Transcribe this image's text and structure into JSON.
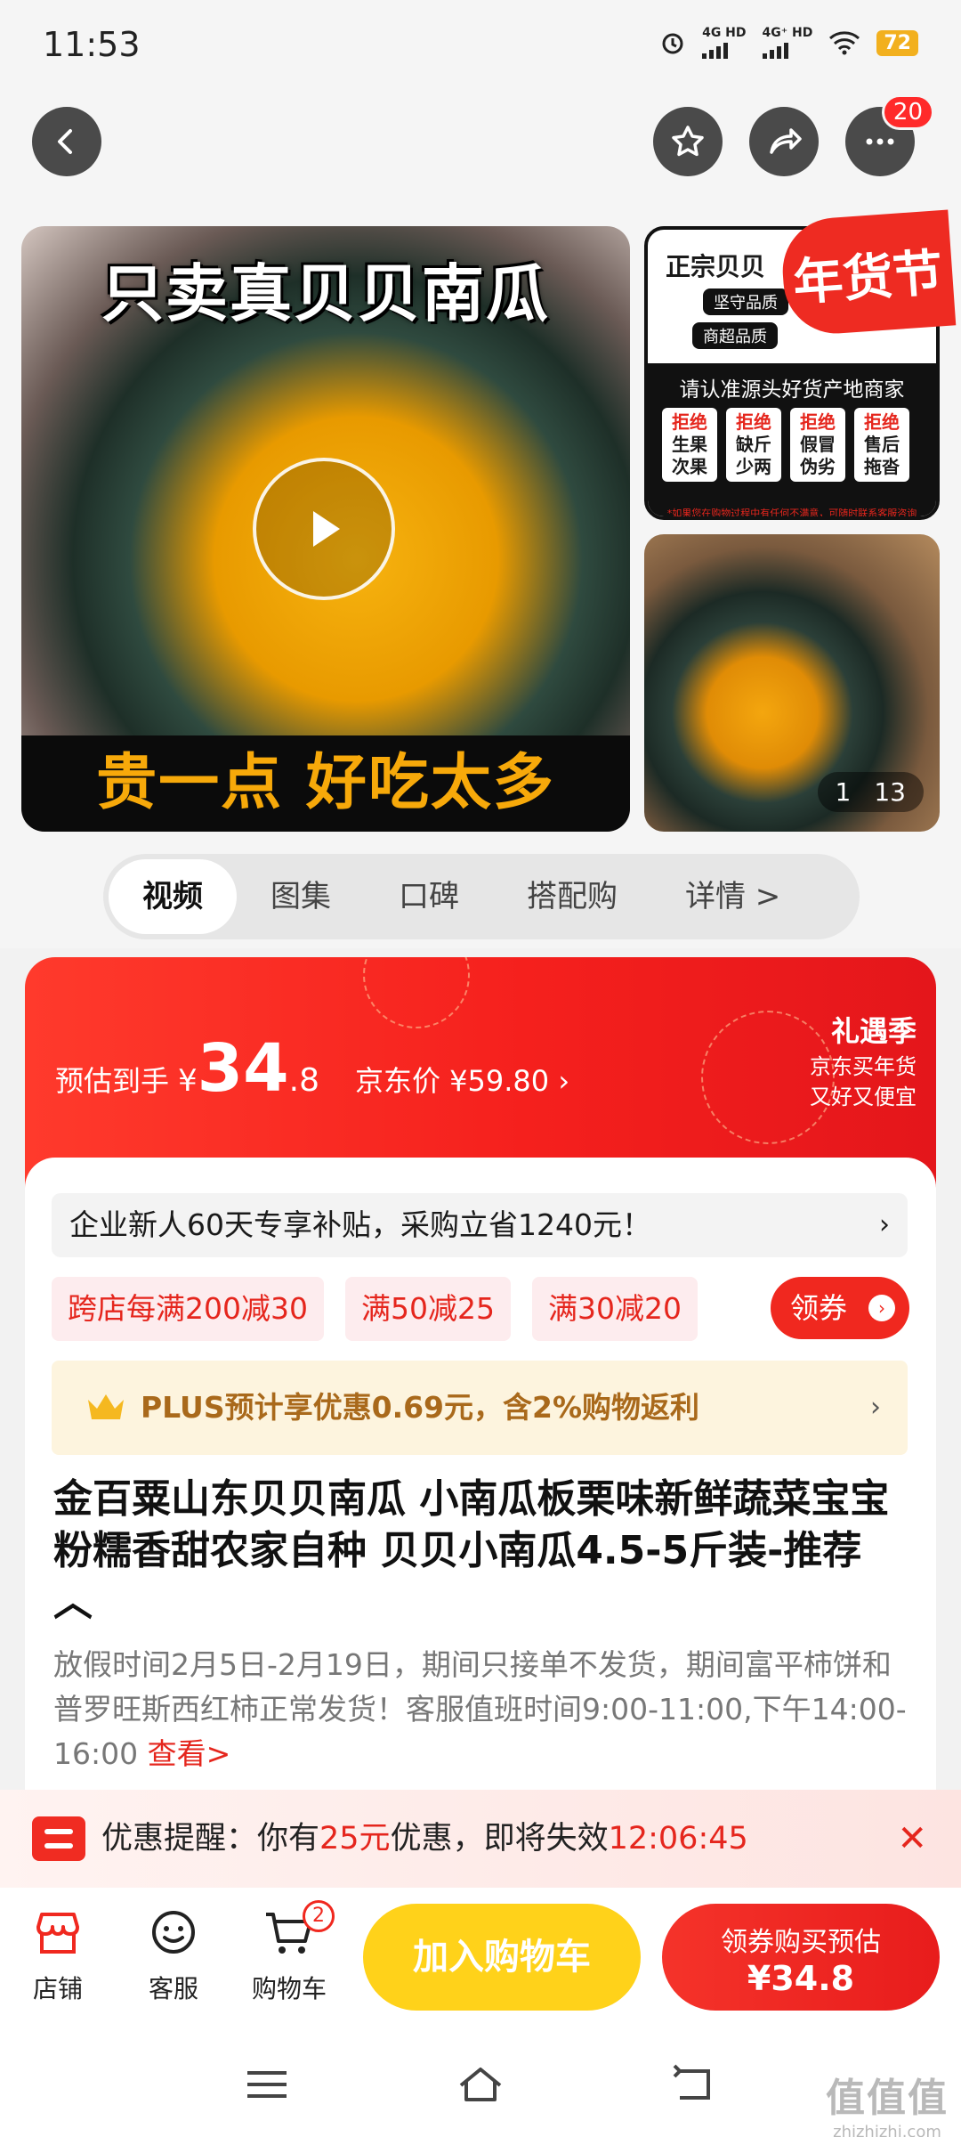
{
  "status_bar": {
    "time": "11:53",
    "signal1": "4G HD",
    "signal2": "4G⁺ HD",
    "battery": "72"
  },
  "nav": {
    "more_badge": "20"
  },
  "gallery": {
    "main_title": "只卖真贝贝南瓜",
    "main_bottom": "贵一点 好吃太多",
    "side_title": "正宗贝贝",
    "side_pill1": "坚守品质",
    "side_pill2": "商超品质",
    "side_heading": "请认准源头好货产地商家",
    "side_cells": [
      {
        "a": "拒绝",
        "b": "生果",
        "c": "次果"
      },
      {
        "a": "拒绝",
        "b": "缺斤",
        "c": "少两"
      },
      {
        "a": "拒绝",
        "b": "假冒",
        "c": "伪劣"
      },
      {
        "a": "拒绝",
        "b": "售后",
        "c": "拖沓"
      }
    ],
    "side_fine": "*如果您在购物过程中有任何不满意，可随时联系客服咨询",
    "festival": "年货节",
    "counter_current": "1",
    "counter_total": "13"
  },
  "tabs": [
    "视频",
    "图集",
    "口碑",
    "搭配购",
    "详情 >"
  ],
  "price": {
    "label": "预估到手",
    "yen": "¥",
    "integer": "34",
    "decimal": ".8",
    "jd_price": "京东价 ¥59.80 ›",
    "promo_title": "礼遇季",
    "promo_line1": "京东买年货",
    "promo_line2": "又好又便宜"
  },
  "subsidy": {
    "text": "企业新人60天专享补贴，采购立省1240元！",
    "arrow": "›"
  },
  "coupons": [
    "跨店每满200减30",
    "满50减25",
    "满30减20"
  ],
  "coupon_button": "领券",
  "plus": {
    "text": "PLUS预计享优惠0.69元，含2%购物返利",
    "arrow": "›"
  },
  "product": {
    "title": "金百粟山东贝贝南瓜 小南瓜板栗味新鲜蔬菜宝宝粉糯香甜农家自种 贝贝小南瓜4.5-5斤装-推荐 ︿",
    "notice": "放假时间2月5日-2月19日，期间只接单不发货，期间富平柿饼和普罗旺斯西红柿正常发货！客服值班时间9:00-11:00,下午14:00-16:00 ",
    "notice_link": "查看>"
  },
  "reminder": {
    "prefix": "优惠提醒：你有",
    "amount": "25元",
    "middle": "优惠，即将失效",
    "countdown": "12:06:45"
  },
  "bottom_bar": {
    "shop": "店铺",
    "service": "客服",
    "cart": "购物车",
    "cart_count": "2",
    "add_to_cart": "加入购物车",
    "buy_line1": "领券购买预估",
    "buy_line2": "¥34.8"
  },
  "watermark": {
    "top": "值值值",
    "bottom": "zhizhizhi.com"
  }
}
